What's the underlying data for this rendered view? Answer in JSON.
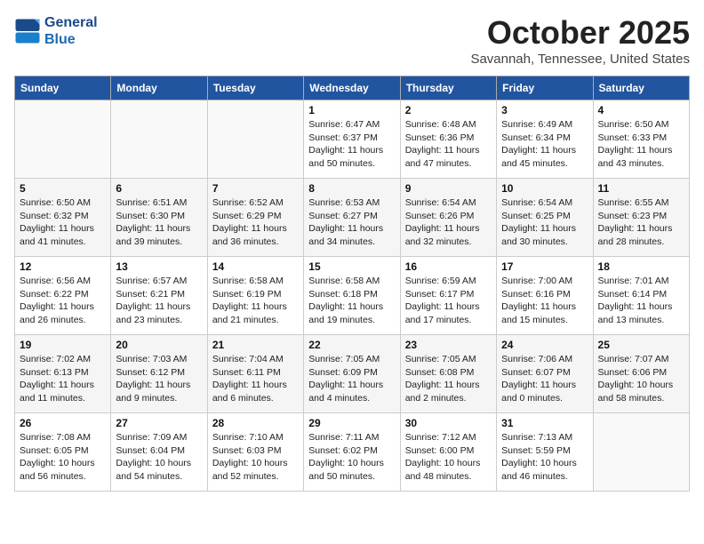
{
  "header": {
    "logo_line1": "General",
    "logo_line2": "Blue",
    "month_title": "October 2025",
    "subtitle": "Savannah, Tennessee, United States"
  },
  "days_of_week": [
    "Sunday",
    "Monday",
    "Tuesday",
    "Wednesday",
    "Thursday",
    "Friday",
    "Saturday"
  ],
  "weeks": [
    [
      {
        "day": "",
        "sunrise": "",
        "sunset": "",
        "daylight": ""
      },
      {
        "day": "",
        "sunrise": "",
        "sunset": "",
        "daylight": ""
      },
      {
        "day": "",
        "sunrise": "",
        "sunset": "",
        "daylight": ""
      },
      {
        "day": "1",
        "sunrise": "Sunrise: 6:47 AM",
        "sunset": "Sunset: 6:37 PM",
        "daylight": "Daylight: 11 hours and 50 minutes."
      },
      {
        "day": "2",
        "sunrise": "Sunrise: 6:48 AM",
        "sunset": "Sunset: 6:36 PM",
        "daylight": "Daylight: 11 hours and 47 minutes."
      },
      {
        "day": "3",
        "sunrise": "Sunrise: 6:49 AM",
        "sunset": "Sunset: 6:34 PM",
        "daylight": "Daylight: 11 hours and 45 minutes."
      },
      {
        "day": "4",
        "sunrise": "Sunrise: 6:50 AM",
        "sunset": "Sunset: 6:33 PM",
        "daylight": "Daylight: 11 hours and 43 minutes."
      }
    ],
    [
      {
        "day": "5",
        "sunrise": "Sunrise: 6:50 AM",
        "sunset": "Sunset: 6:32 PM",
        "daylight": "Daylight: 11 hours and 41 minutes."
      },
      {
        "day": "6",
        "sunrise": "Sunrise: 6:51 AM",
        "sunset": "Sunset: 6:30 PM",
        "daylight": "Daylight: 11 hours and 39 minutes."
      },
      {
        "day": "7",
        "sunrise": "Sunrise: 6:52 AM",
        "sunset": "Sunset: 6:29 PM",
        "daylight": "Daylight: 11 hours and 36 minutes."
      },
      {
        "day": "8",
        "sunrise": "Sunrise: 6:53 AM",
        "sunset": "Sunset: 6:27 PM",
        "daylight": "Daylight: 11 hours and 34 minutes."
      },
      {
        "day": "9",
        "sunrise": "Sunrise: 6:54 AM",
        "sunset": "Sunset: 6:26 PM",
        "daylight": "Daylight: 11 hours and 32 minutes."
      },
      {
        "day": "10",
        "sunrise": "Sunrise: 6:54 AM",
        "sunset": "Sunset: 6:25 PM",
        "daylight": "Daylight: 11 hours and 30 minutes."
      },
      {
        "day": "11",
        "sunrise": "Sunrise: 6:55 AM",
        "sunset": "Sunset: 6:23 PM",
        "daylight": "Daylight: 11 hours and 28 minutes."
      }
    ],
    [
      {
        "day": "12",
        "sunrise": "Sunrise: 6:56 AM",
        "sunset": "Sunset: 6:22 PM",
        "daylight": "Daylight: 11 hours and 26 minutes."
      },
      {
        "day": "13",
        "sunrise": "Sunrise: 6:57 AM",
        "sunset": "Sunset: 6:21 PM",
        "daylight": "Daylight: 11 hours and 23 minutes."
      },
      {
        "day": "14",
        "sunrise": "Sunrise: 6:58 AM",
        "sunset": "Sunset: 6:19 PM",
        "daylight": "Daylight: 11 hours and 21 minutes."
      },
      {
        "day": "15",
        "sunrise": "Sunrise: 6:58 AM",
        "sunset": "Sunset: 6:18 PM",
        "daylight": "Daylight: 11 hours and 19 minutes."
      },
      {
        "day": "16",
        "sunrise": "Sunrise: 6:59 AM",
        "sunset": "Sunset: 6:17 PM",
        "daylight": "Daylight: 11 hours and 17 minutes."
      },
      {
        "day": "17",
        "sunrise": "Sunrise: 7:00 AM",
        "sunset": "Sunset: 6:16 PM",
        "daylight": "Daylight: 11 hours and 15 minutes."
      },
      {
        "day": "18",
        "sunrise": "Sunrise: 7:01 AM",
        "sunset": "Sunset: 6:14 PM",
        "daylight": "Daylight: 11 hours and 13 minutes."
      }
    ],
    [
      {
        "day": "19",
        "sunrise": "Sunrise: 7:02 AM",
        "sunset": "Sunset: 6:13 PM",
        "daylight": "Daylight: 11 hours and 11 minutes."
      },
      {
        "day": "20",
        "sunrise": "Sunrise: 7:03 AM",
        "sunset": "Sunset: 6:12 PM",
        "daylight": "Daylight: 11 hours and 9 minutes."
      },
      {
        "day": "21",
        "sunrise": "Sunrise: 7:04 AM",
        "sunset": "Sunset: 6:11 PM",
        "daylight": "Daylight: 11 hours and 6 minutes."
      },
      {
        "day": "22",
        "sunrise": "Sunrise: 7:05 AM",
        "sunset": "Sunset: 6:09 PM",
        "daylight": "Daylight: 11 hours and 4 minutes."
      },
      {
        "day": "23",
        "sunrise": "Sunrise: 7:05 AM",
        "sunset": "Sunset: 6:08 PM",
        "daylight": "Daylight: 11 hours and 2 minutes."
      },
      {
        "day": "24",
        "sunrise": "Sunrise: 7:06 AM",
        "sunset": "Sunset: 6:07 PM",
        "daylight": "Daylight: 11 hours and 0 minutes."
      },
      {
        "day": "25",
        "sunrise": "Sunrise: 7:07 AM",
        "sunset": "Sunset: 6:06 PM",
        "daylight": "Daylight: 10 hours and 58 minutes."
      }
    ],
    [
      {
        "day": "26",
        "sunrise": "Sunrise: 7:08 AM",
        "sunset": "Sunset: 6:05 PM",
        "daylight": "Daylight: 10 hours and 56 minutes."
      },
      {
        "day": "27",
        "sunrise": "Sunrise: 7:09 AM",
        "sunset": "Sunset: 6:04 PM",
        "daylight": "Daylight: 10 hours and 54 minutes."
      },
      {
        "day": "28",
        "sunrise": "Sunrise: 7:10 AM",
        "sunset": "Sunset: 6:03 PM",
        "daylight": "Daylight: 10 hours and 52 minutes."
      },
      {
        "day": "29",
        "sunrise": "Sunrise: 7:11 AM",
        "sunset": "Sunset: 6:02 PM",
        "daylight": "Daylight: 10 hours and 50 minutes."
      },
      {
        "day": "30",
        "sunrise": "Sunrise: 7:12 AM",
        "sunset": "Sunset: 6:00 PM",
        "daylight": "Daylight: 10 hours and 48 minutes."
      },
      {
        "day": "31",
        "sunrise": "Sunrise: 7:13 AM",
        "sunset": "Sunset: 5:59 PM",
        "daylight": "Daylight: 10 hours and 46 minutes."
      },
      {
        "day": "",
        "sunrise": "",
        "sunset": "",
        "daylight": ""
      }
    ]
  ]
}
